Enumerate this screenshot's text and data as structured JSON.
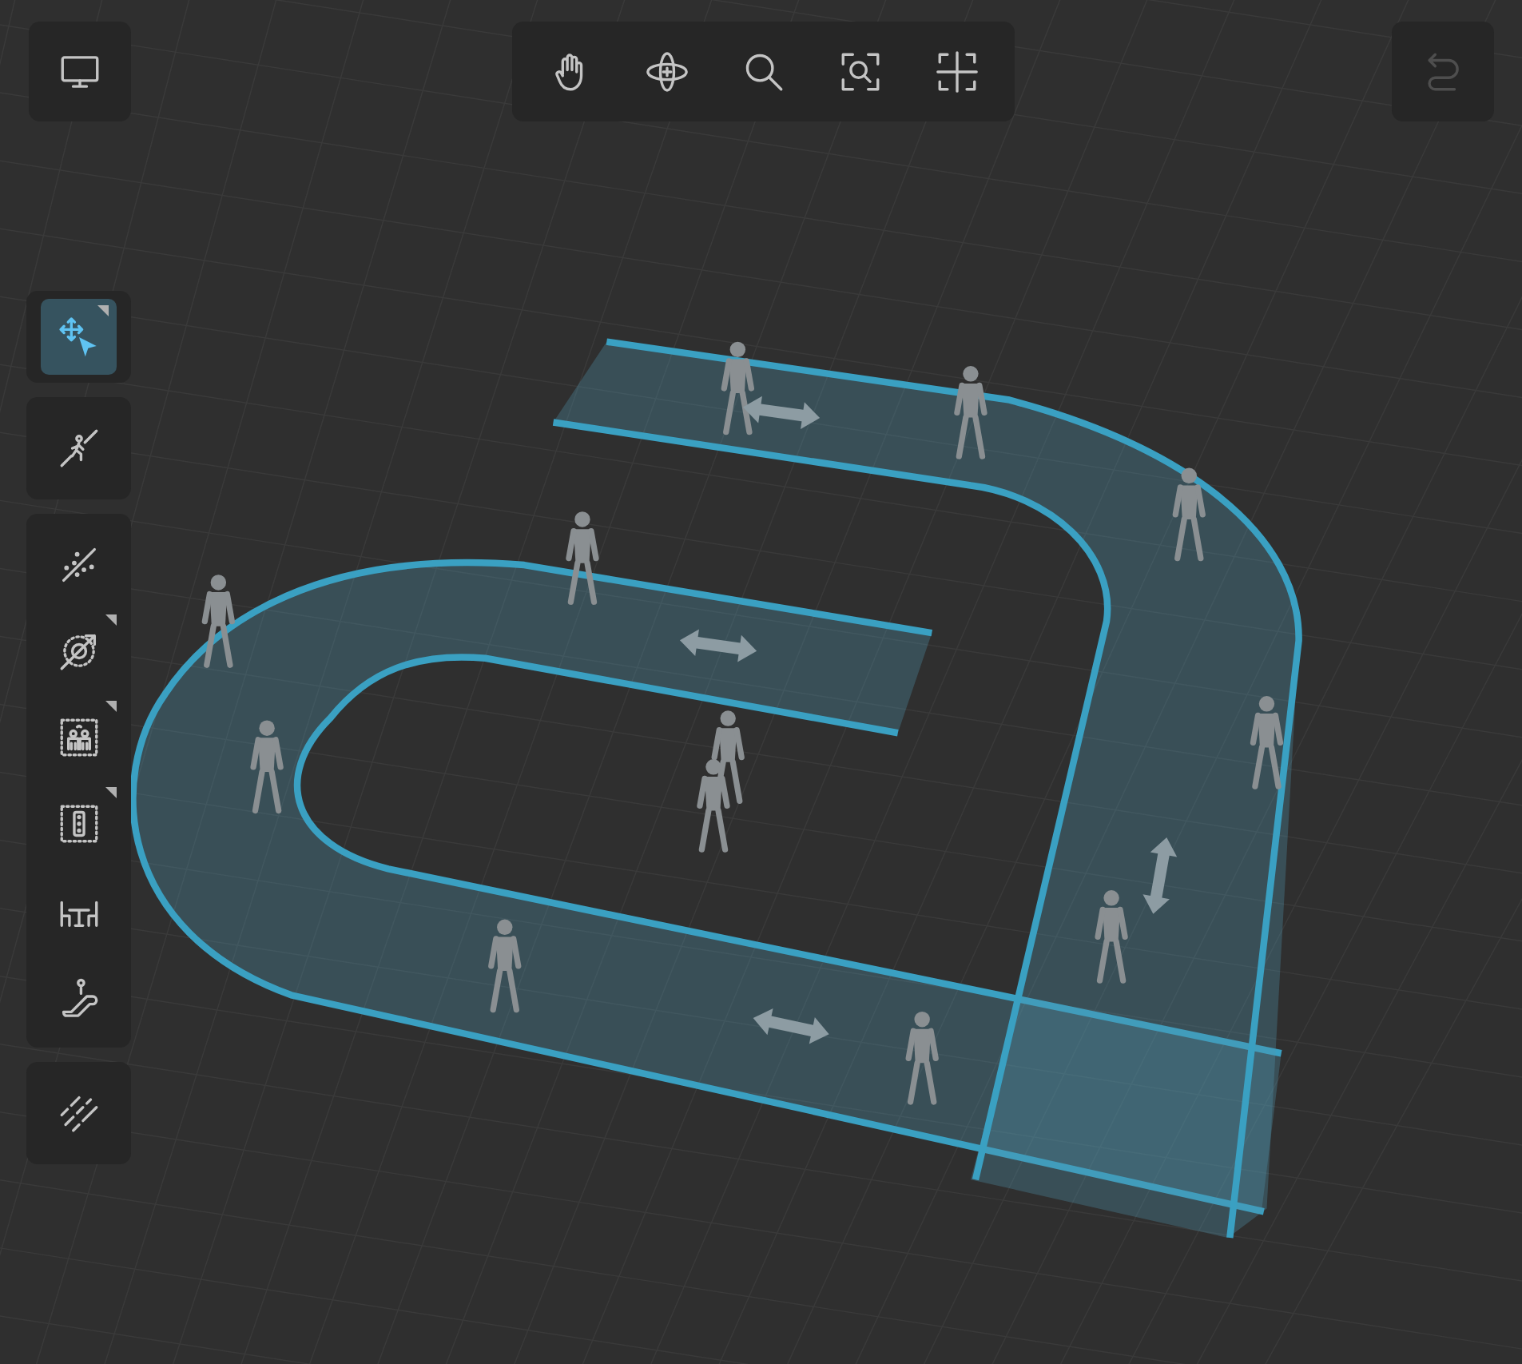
{
  "view_button": {
    "selected": false
  },
  "navigation_toolbar": {
    "tools": [
      {
        "selected": false
      },
      {
        "selected": false
      },
      {
        "selected": false
      },
      {
        "selected": false
      },
      {
        "selected": false
      }
    ]
  },
  "undo_button": {
    "disabled": true
  },
  "tool_groups": [
    {
      "tools": [
        {
          "selected": true,
          "submenu": true
        }
      ]
    },
    {
      "tools": [
        {
          "selected": false,
          "submenu": false
        }
      ]
    },
    {
      "tools": [
        {
          "selected": false,
          "submenu": false
        },
        {
          "selected": false,
          "submenu": true
        },
        {
          "selected": false,
          "submenu": true
        },
        {
          "selected": false,
          "submenu": true
        },
        {
          "selected": false,
          "submenu": false
        },
        {
          "selected": false,
          "submenu": false
        }
      ]
    },
    {
      "tools": [
        {
          "selected": false,
          "submenu": false
        }
      ]
    }
  ]
}
